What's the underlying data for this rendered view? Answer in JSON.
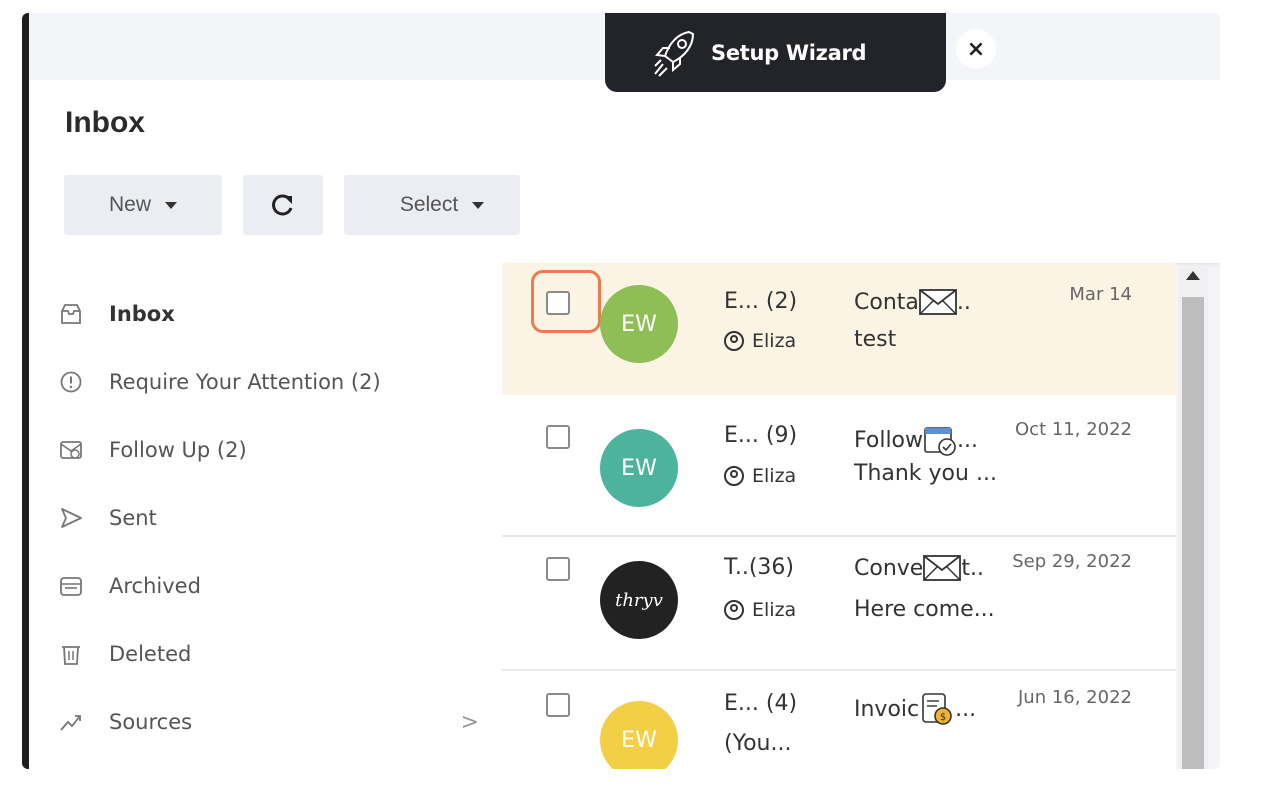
{
  "wizard": {
    "label": "Setup Wizard",
    "close": "×"
  },
  "header": {
    "title": "Inbox",
    "new_label": "New",
    "select_label": "Select"
  },
  "sidebar": {
    "items": [
      {
        "label": "Inbox",
        "icon": "inbox-tray-icon"
      },
      {
        "label": "Require Your Attention (2)",
        "icon": "alert-circle-icon"
      },
      {
        "label": "Follow Up (2)",
        "icon": "follow-up-envelope-icon"
      },
      {
        "label": "Sent",
        "icon": "send-icon"
      },
      {
        "label": "Archived",
        "icon": "archive-box-icon"
      },
      {
        "label": "Deleted",
        "icon": "trash-icon"
      },
      {
        "label": "Sources",
        "icon": "trend-line-icon",
        "chevron": ">"
      }
    ]
  },
  "messages": [
    {
      "sender": "E... (2)",
      "owner": "Eliza",
      "subject": "Conta",
      "subject_tail": "..",
      "preview": "test",
      "date": "Mar 14",
      "avatar_text": "EW",
      "avatar_color": "#8fbe57",
      "icon": "envelope-icon"
    },
    {
      "sender": "E... (9)",
      "owner": "Eliza",
      "subject": "Follow",
      "subject_tail": "...",
      "preview": "Thank you ...",
      "date": "Oct 11, 2022",
      "avatar_text": "EW",
      "avatar_color": "#4db39c",
      "icon": "calendar-check-icon"
    },
    {
      "sender": "T..(36)",
      "owner": "Eliza",
      "subject": "Conve",
      "subject_tail": "t..",
      "preview": "Here come...",
      "date": "Sep 29, 2022",
      "avatar_text": "thryv",
      "avatar_color": "#222222",
      "icon": "envelope-icon"
    },
    {
      "sender": "E... (4)",
      "owner": "(You...",
      "subject": "Invoic",
      "subject_tail": "...",
      "preview": "",
      "date": "Jun 16, 2022",
      "avatar_text": "EW",
      "avatar_color": "#f2cf45",
      "icon": "invoice-icon"
    }
  ]
}
